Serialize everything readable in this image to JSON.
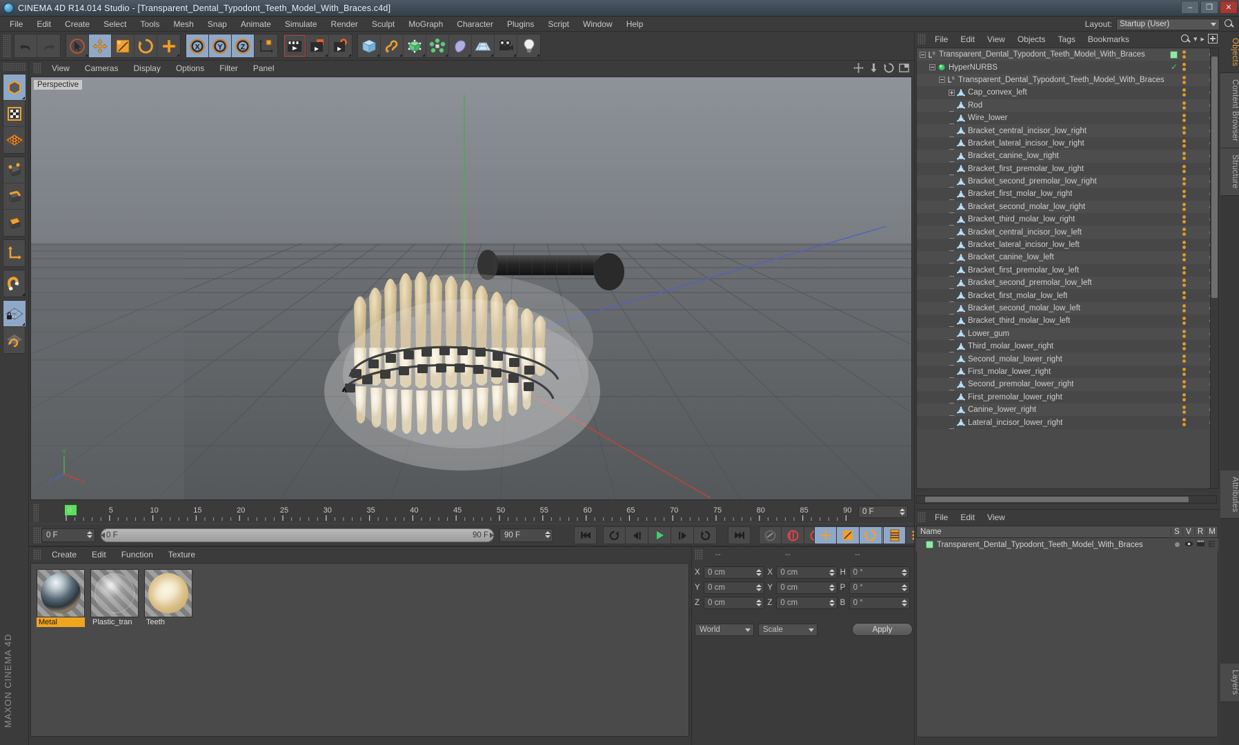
{
  "window": {
    "title": "CINEMA 4D R14.014 Studio - [Transparent_Dental_Typodont_Teeth_Model_With_Braces.c4d]",
    "minimize": "–",
    "maximize": "❐",
    "close": "✕"
  },
  "menubar": {
    "items": [
      "File",
      "Edit",
      "Create",
      "Select",
      "Tools",
      "Mesh",
      "Snap",
      "Animate",
      "Simulate",
      "Render",
      "Sculpt",
      "MoGraph",
      "Character",
      "Plugins",
      "Script",
      "Window",
      "Help"
    ],
    "layout_label": "Layout:",
    "layout_value": "Startup (User)"
  },
  "viewport": {
    "menu": [
      "View",
      "Cameras",
      "Display",
      "Options",
      "Filter",
      "Panel"
    ],
    "camera_tag": "Perspective",
    "axis_x": "X",
    "axis_y": "Y",
    "axis_z": "Z"
  },
  "timeline": {
    "ticks": [
      "0",
      "5",
      "10",
      "15",
      "20",
      "25",
      "30",
      "35",
      "40",
      "45",
      "50",
      "55",
      "60",
      "65",
      "70",
      "75",
      "80",
      "85",
      "90"
    ],
    "current_frame_field": "0 F",
    "start_field": "0 F",
    "range_left": "0 F",
    "range_right": "90 F",
    "end_field": "90 F"
  },
  "materials": {
    "menu": [
      "Create",
      "Edit",
      "Function",
      "Texture"
    ],
    "items": [
      {
        "name": "Metal",
        "selected": true
      },
      {
        "name": "Plastic_tran",
        "selected": false
      },
      {
        "name": "Teeth",
        "selected": false
      }
    ]
  },
  "coordinates": {
    "headers": [
      "--",
      "--",
      "--"
    ],
    "rows": [
      {
        "pos_label": "X",
        "pos_value": "0 cm",
        "size_label": "X",
        "size_value": "0 cm",
        "rot_label": "H",
        "rot_value": "0 °"
      },
      {
        "pos_label": "Y",
        "pos_value": "0 cm",
        "size_label": "Y",
        "size_value": "0 cm",
        "rot_label": "P",
        "rot_value": "0 °"
      },
      {
        "pos_label": "Z",
        "pos_value": "0 cm",
        "size_label": "Z",
        "size_value": "0 cm",
        "rot_label": "B",
        "rot_value": "0 °"
      }
    ],
    "system": "World",
    "mode": "Scale",
    "apply": "Apply"
  },
  "object_manager": {
    "menu": [
      "File",
      "Edit",
      "View",
      "Objects",
      "Tags",
      "Bookmarks"
    ],
    "items": [
      {
        "label": "Transparent_Dental_Typodont_Teeth_Model_With_Braces",
        "depth": 0,
        "icon": "null-object-icon",
        "expander": "minus"
      },
      {
        "label": "HyperNURBS",
        "depth": 1,
        "icon": "hypernurbs-icon",
        "expander": "minus"
      },
      {
        "label": "Transparent_Dental_Typodont_Teeth_Model_With_Braces",
        "depth": 2,
        "icon": "null-object-icon",
        "expander": "minus"
      },
      {
        "label": "Cap_convex_left",
        "depth": 3,
        "icon": "polygon-object-icon",
        "expander": "plus"
      },
      {
        "label": "Rod",
        "depth": 3,
        "icon": "polygon-object-icon",
        "expander": "none"
      },
      {
        "label": "Wire_lower",
        "depth": 3,
        "icon": "polygon-object-icon",
        "expander": "none"
      },
      {
        "label": "Bracket_central_incisor_low_right",
        "depth": 3,
        "icon": "polygon-object-icon",
        "expander": "none"
      },
      {
        "label": "Bracket_lateral_incisor_low_right",
        "depth": 3,
        "icon": "polygon-object-icon",
        "expander": "none"
      },
      {
        "label": "Bracket_canine_low_right",
        "depth": 3,
        "icon": "polygon-object-icon",
        "expander": "none"
      },
      {
        "label": "Bracket_first_premolar_low_right",
        "depth": 3,
        "icon": "polygon-object-icon",
        "expander": "none"
      },
      {
        "label": "Bracket_second_premolar_low_right",
        "depth": 3,
        "icon": "polygon-object-icon",
        "expander": "none"
      },
      {
        "label": "Bracket_first_molar_low_right",
        "depth": 3,
        "icon": "polygon-object-icon",
        "expander": "none"
      },
      {
        "label": "Bracket_second_molar_low_right",
        "depth": 3,
        "icon": "polygon-object-icon",
        "expander": "none"
      },
      {
        "label": "Bracket_third_molar_low_right",
        "depth": 3,
        "icon": "polygon-object-icon",
        "expander": "none"
      },
      {
        "label": "Bracket_central_incisor_low_left",
        "depth": 3,
        "icon": "polygon-object-icon",
        "expander": "none"
      },
      {
        "label": "Bracket_lateral_incisor_low_left",
        "depth": 3,
        "icon": "polygon-object-icon",
        "expander": "none"
      },
      {
        "label": "Bracket_canine_low_left",
        "depth": 3,
        "icon": "polygon-object-icon",
        "expander": "none"
      },
      {
        "label": "Bracket_first_premolar_low_left",
        "depth": 3,
        "icon": "polygon-object-icon",
        "expander": "none"
      },
      {
        "label": "Bracket_second_premolar_low_left",
        "depth": 3,
        "icon": "polygon-object-icon",
        "expander": "none"
      },
      {
        "label": "Bracket_first_molar_low_left",
        "depth": 3,
        "icon": "polygon-object-icon",
        "expander": "none"
      },
      {
        "label": "Bracket_second_molar_low_left",
        "depth": 3,
        "icon": "polygon-object-icon",
        "expander": "none"
      },
      {
        "label": "Bracket_third_molar_low_left",
        "depth": 3,
        "icon": "polygon-object-icon",
        "expander": "none"
      },
      {
        "label": "Lower_gum",
        "depth": 3,
        "icon": "polygon-object-icon",
        "expander": "none"
      },
      {
        "label": "Third_molar_lower_right",
        "depth": 3,
        "icon": "polygon-object-icon",
        "expander": "none"
      },
      {
        "label": "Second_molar_lower_right",
        "depth": 3,
        "icon": "polygon-object-icon",
        "expander": "none"
      },
      {
        "label": "First_molar_lower_right",
        "depth": 3,
        "icon": "polygon-object-icon",
        "expander": "none"
      },
      {
        "label": "Second_premolar_lower_right",
        "depth": 3,
        "icon": "polygon-object-icon",
        "expander": "none"
      },
      {
        "label": "First_premolar_lower_right",
        "depth": 3,
        "icon": "polygon-object-icon",
        "expander": "none"
      },
      {
        "label": "Canine_lower_right",
        "depth": 3,
        "icon": "polygon-object-icon",
        "expander": "none"
      },
      {
        "label": "Lateral_incisor_lower_right",
        "depth": 3,
        "icon": "polygon-object-icon",
        "expander": "none"
      }
    ]
  },
  "structure_panel": {
    "menu": [
      "File",
      "Edit",
      "View"
    ],
    "columns": [
      "Name",
      "S",
      "V",
      "R",
      "M"
    ],
    "row_label": "Transparent_Dental_Typodont_Teeth_Model_With_Braces"
  },
  "right_tabs": [
    {
      "label": "Objects",
      "active": true
    },
    {
      "label": "Content Browser",
      "active": false
    },
    {
      "label": "Structure",
      "active": false
    },
    {
      "label": "Attributes",
      "active": false
    },
    {
      "label": "Layers",
      "active": false
    }
  ],
  "branding": {
    "line1": "MAXON",
    "line2": "CINEMA 4D"
  }
}
